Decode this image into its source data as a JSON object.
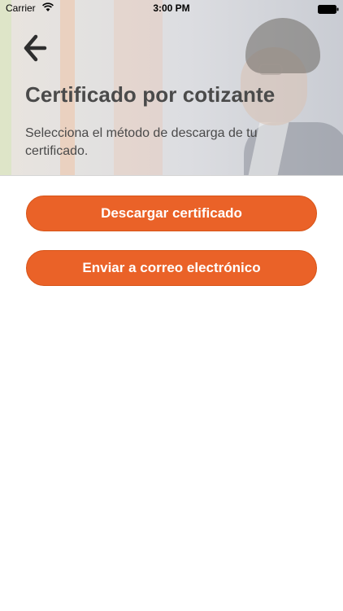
{
  "status_bar": {
    "carrier": "Carrier",
    "time": "3:00 PM",
    "wifi_icon": "wifi-icon",
    "battery_icon": "battery-icon"
  },
  "header": {
    "back_icon": "back-arrow-icon",
    "title": "Certificado por cotizante",
    "subtitle": "Selecciona el método de descarga de tu certificado."
  },
  "actions": {
    "download_label": "Descargar certificado",
    "email_label": "Enviar a correo electrónico"
  },
  "colors": {
    "accent": "#ea6228",
    "text": "#4a4a4a",
    "background": "#ffffff"
  }
}
